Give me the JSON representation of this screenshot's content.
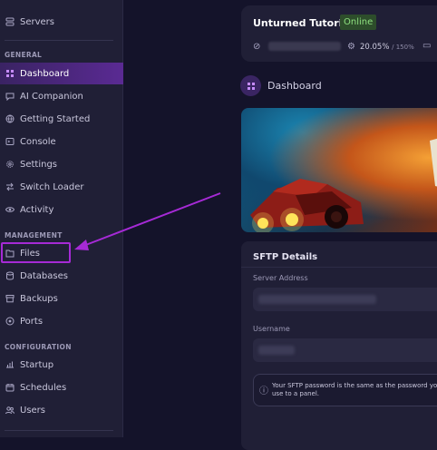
{
  "sidebar": {
    "top_item": {
      "label": "Servers",
      "icon": "servers-icon"
    },
    "sections": {
      "general": "GENERAL",
      "management": "MANAGEMENT",
      "configuration": "CONFIGURATION"
    },
    "general_items": [
      {
        "label": "Dashboard",
        "icon": "dashboard-icon",
        "active": true
      },
      {
        "label": "AI Companion",
        "icon": "chat-bubble-icon"
      },
      {
        "label": "Getting Started",
        "icon": "globe-icon"
      },
      {
        "label": "Console",
        "icon": "terminal-icon"
      },
      {
        "label": "Settings",
        "icon": "gear-icon"
      },
      {
        "label": "Switch Loader",
        "icon": "switch-arrows-icon"
      },
      {
        "label": "Activity",
        "icon": "eye-icon"
      }
    ],
    "management_items": [
      {
        "label": "Files",
        "icon": "folder-icon"
      },
      {
        "label": "Databases",
        "icon": "database-icon"
      },
      {
        "label": "Backups",
        "icon": "archive-icon"
      },
      {
        "label": "Ports",
        "icon": "network-icon"
      }
    ],
    "configuration_items": [
      {
        "label": "Startup",
        "icon": "startup-icon"
      },
      {
        "label": "Schedules",
        "icon": "calendar-icon"
      },
      {
        "label": "Users",
        "icon": "users-icon"
      }
    ]
  },
  "server": {
    "name": "Unturned Tutorials",
    "status": "Online",
    "cpu_value": "20.05%",
    "cpu_limit": "/ 150%",
    "colors": {
      "status_bg": "#2d4d2b",
      "status_text": "#8ee07f"
    }
  },
  "dashboard": {
    "heading": "Dashboard"
  },
  "sftp": {
    "title": "SFTP Details",
    "server_address_label": "Server Address",
    "username_label": "Username",
    "info_text": "Your SFTP password is the same as the password you use to a panel."
  },
  "colors": {
    "accent": "#a62ad6",
    "active_bg": "#5a2a93",
    "sidebar_bg": "#201f36",
    "page_bg": "#14132a"
  }
}
